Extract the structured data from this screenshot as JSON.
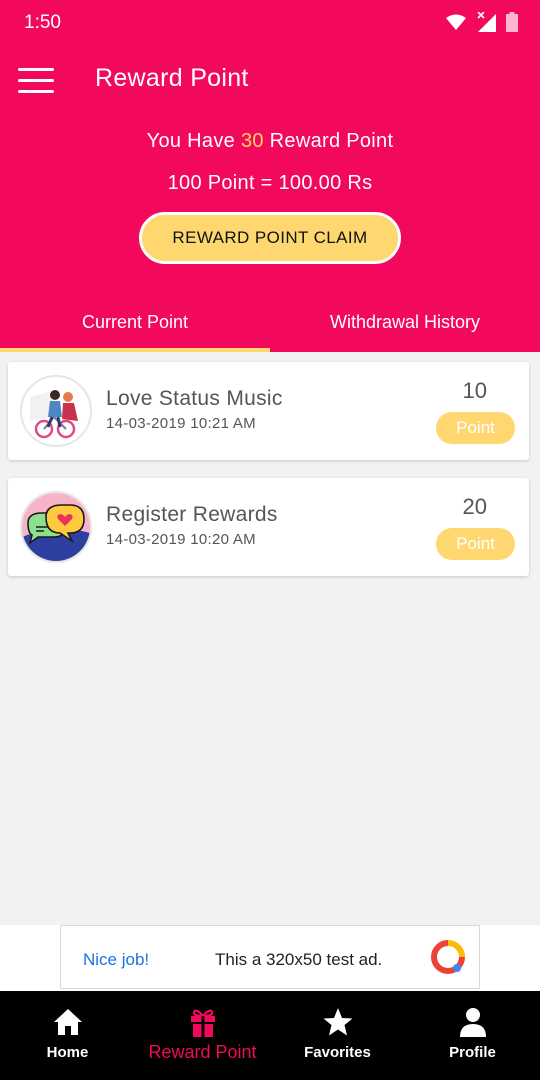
{
  "status_bar": {
    "time": "1:50"
  },
  "app_bar": {
    "title": "Reward Point"
  },
  "summary": {
    "prefix": "You Have",
    "points": "30",
    "suffix": "Reward Point",
    "rate": "100 Point = 100.00 Rs",
    "claim_button": "REWARD POINT CLAIM"
  },
  "tabs": [
    {
      "label": "Current Point",
      "selected": true
    },
    {
      "label": "Withdrawal History",
      "selected": false
    }
  ],
  "items": [
    {
      "title": "Love Status Music",
      "date": "14-03-2019 10:21 AM",
      "points": "10",
      "badge": "Point"
    },
    {
      "title": "Register Rewards",
      "date": "14-03-2019 10:20 AM",
      "points": "20",
      "badge": "Point"
    }
  ],
  "ad": {
    "nice": "Nice job!",
    "text": "This a 320x50 test ad."
  },
  "bottom_nav": [
    {
      "label": "Home",
      "icon": "home-icon"
    },
    {
      "label": "Reward Point",
      "icon": "gift-icon",
      "active": true
    },
    {
      "label": "Favorites",
      "icon": "star-icon"
    },
    {
      "label": "Profile",
      "icon": "person-icon"
    }
  ],
  "colors": {
    "primary": "#f2085c",
    "accent": "#ffd770",
    "highlight": "#ffd75e",
    "background": "#f2f2f2"
  }
}
